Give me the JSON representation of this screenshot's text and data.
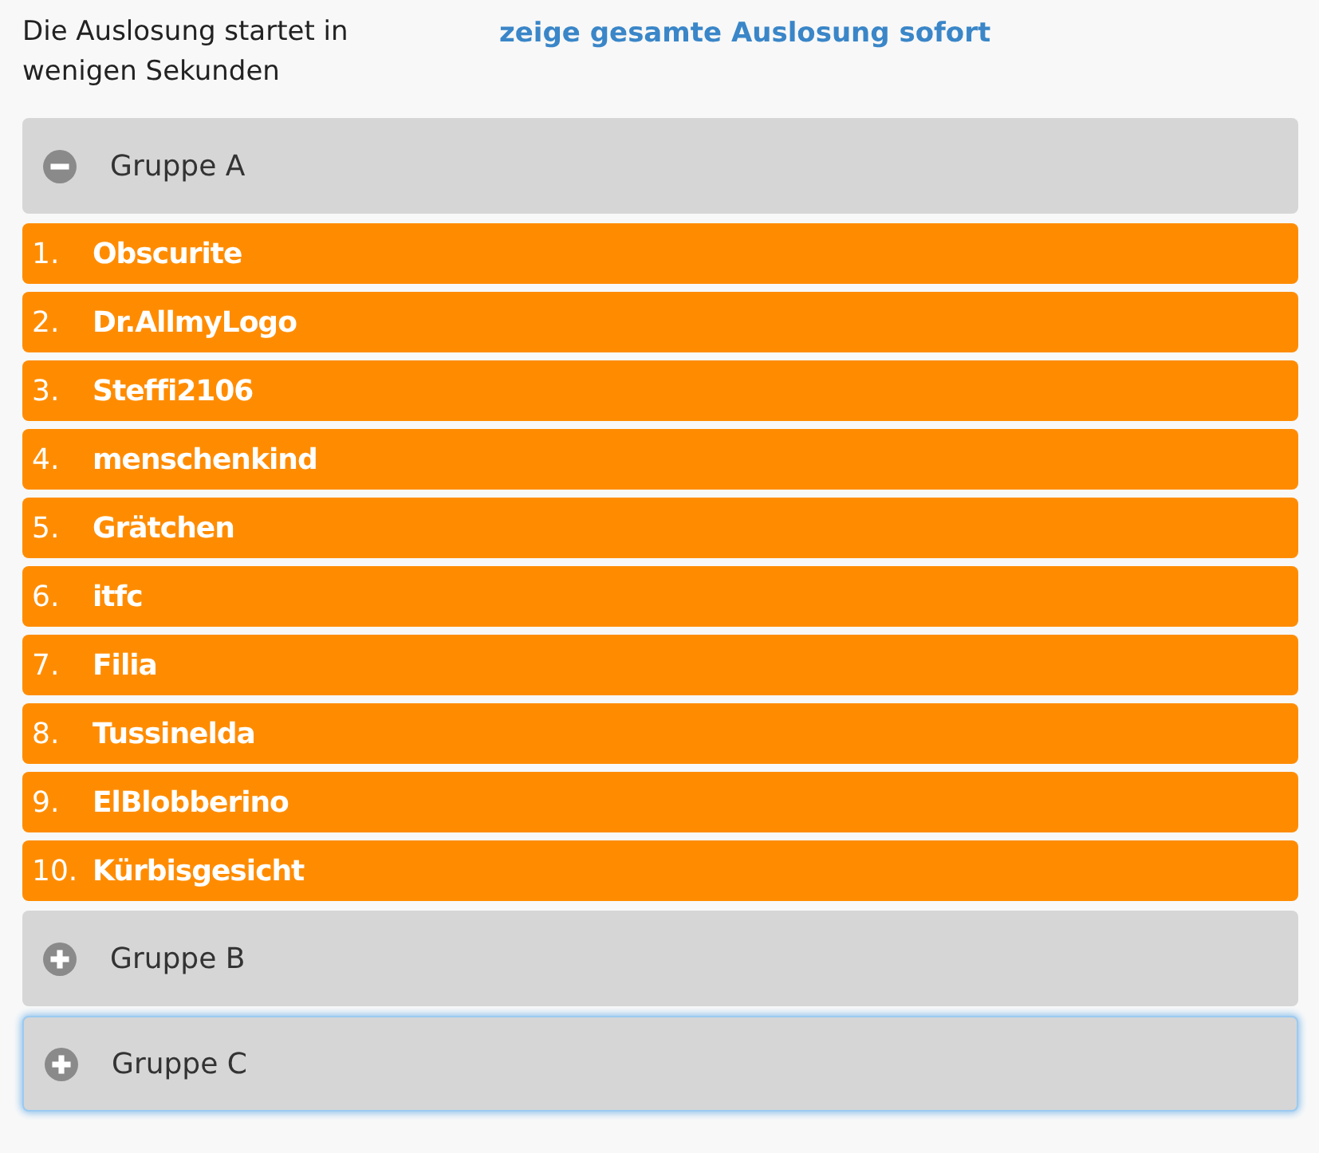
{
  "intro": {
    "status": "Die Auslosung startet in wenigen Sekunden",
    "link": "zeige gesamte Auslosung sofort"
  },
  "groups": [
    {
      "title": "Gruppe A",
      "expanded": true,
      "focused": false,
      "entries": [
        {
          "rank": "1.",
          "name": "Obscurite"
        },
        {
          "rank": "2.",
          "name": "Dr.AllmyLogo"
        },
        {
          "rank": "3.",
          "name": "Steffi2106"
        },
        {
          "rank": "4.",
          "name": "menschenkind"
        },
        {
          "rank": "5.",
          "name": "Grätchen"
        },
        {
          "rank": "6.",
          "name": "itfc"
        },
        {
          "rank": "7.",
          "name": "Filia"
        },
        {
          "rank": "8.",
          "name": "Tussinelda"
        },
        {
          "rank": "9.",
          "name": "ElBlobberino"
        },
        {
          "rank": "10.",
          "name": "Kürbisgesicht"
        }
      ]
    },
    {
      "title": "Gruppe B",
      "expanded": false,
      "focused": false
    },
    {
      "title": "Gruppe C",
      "expanded": false,
      "focused": true
    }
  ]
}
